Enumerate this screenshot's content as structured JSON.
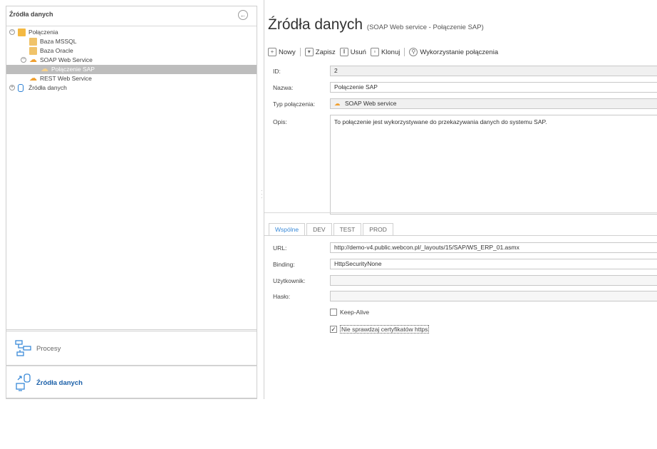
{
  "left_panel": {
    "title": "Źródła danych",
    "collapse_icon": "arrow-left-circle-icon",
    "tree": [
      {
        "label": "Połączenia",
        "icon": "folder-icon",
        "expander": "⊖"
      },
      {
        "label": "Baza MSSQL",
        "icon": "database-icon"
      },
      {
        "label": "Baza Oracle",
        "icon": "database-icon"
      },
      {
        "label": "SOAP Web Service",
        "icon": "cloud-icon",
        "expander": "⊖"
      },
      {
        "label": "Połączenie SAP",
        "icon": "cloud-icon",
        "selected": true
      },
      {
        "label": "REST Web Service",
        "icon": "cloud-icon"
      },
      {
        "label": "Źródła danych",
        "icon": "database-blue-icon",
        "expander": "⊕"
      }
    ]
  },
  "nav": {
    "procesy": "Procesy",
    "zrodla": "Źródła danych"
  },
  "header": {
    "title": "Źródła danych",
    "subtitle": "(SOAP Web service - Połączenie SAP)"
  },
  "toolbar": {
    "new": "Nowy",
    "save": "Zapisz",
    "delete": "Usuń",
    "clone": "Klonuj",
    "usage": "Wykorzystanie połączenia"
  },
  "form": {
    "id_label": "ID:",
    "id_value": "2",
    "name_label": "Nazwa:",
    "name_value": "Połączenie SAP",
    "type_label": "Typ połączenia:",
    "type_value": "SOAP Web service",
    "desc_label": "Opis:",
    "desc_value": "To połączenie jest wykorzystywane do przekazywania danych do systemu SAP."
  },
  "tabs": [
    "Wspólne",
    "DEV",
    "TEST",
    "PROD"
  ],
  "common": {
    "url_label": "URL:",
    "url_value": "http://demo-v4.public.webcon.pl/_layouts/15/SAP/WS_ERP_01.asmx",
    "binding_label": "Binding:",
    "binding_value": "HttpSecurityNone",
    "user_label": "Użytkownik:",
    "user_value": "",
    "password_label": "Hasło:",
    "password_value": "",
    "keepalive_label": "Keep-Alive",
    "keepalive_checked": false,
    "nocert_label": "Nie sprawdzaj certyfikatów https",
    "nocert_checked": true
  }
}
